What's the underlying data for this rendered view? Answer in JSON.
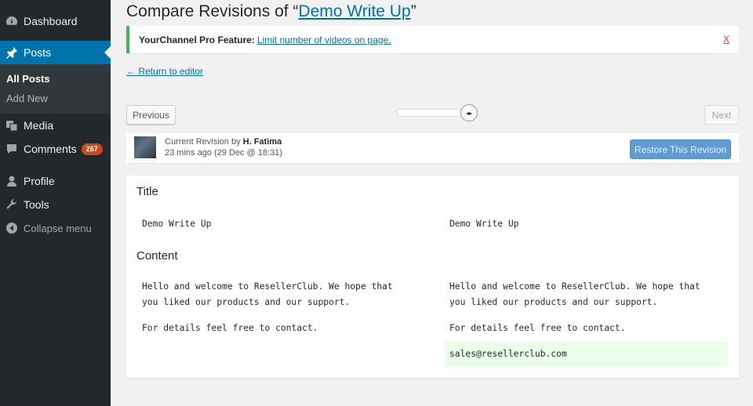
{
  "sidebar": {
    "items": [
      {
        "key": "dashboard",
        "label": "Dashboard",
        "icon": "dashboard-icon"
      },
      {
        "key": "posts",
        "label": "Posts",
        "icon": "pin-icon"
      },
      {
        "key": "media",
        "label": "Media",
        "icon": "media-icon"
      },
      {
        "key": "comments",
        "label": "Comments",
        "icon": "comment-icon",
        "badge": "267"
      },
      {
        "key": "profile",
        "label": "Profile",
        "icon": "user-icon"
      },
      {
        "key": "tools",
        "label": "Tools",
        "icon": "wrench-icon"
      }
    ],
    "submenu": [
      "All Posts",
      "Add New"
    ],
    "collapse_label": "Collapse menu"
  },
  "page": {
    "title_prefix": "Compare Revisions of “",
    "title_link": "Demo Write Up",
    "title_suffix": "”"
  },
  "notice": {
    "label": "YourChannel Pro Feature:",
    "link": "Limit number of videos on page.",
    "dismiss": "X"
  },
  "return_link": "← Return to editor",
  "nav": {
    "previous": "Previous",
    "next": "Next",
    "slider_glyph": "◂▸"
  },
  "revision": {
    "label": "Current Revision by",
    "author": "H. Fatima",
    "time": "23 mins ago (29 Dec @ 18:31)",
    "restore": "Restore This Revision"
  },
  "diff": {
    "title_heading": "Title",
    "content_heading": "Content",
    "left": {
      "title": "Demo Write Up",
      "content_line1": "Hello and welcome to ResellerClub. We hope that",
      "content_line2": "you liked our products and our support.",
      "content_line3": "For details feel free to contact."
    },
    "right": {
      "title": "Demo Write Up",
      "content_line1": "Hello and welcome to ResellerClub. We hope that",
      "content_line2": "you liked our products and our support.",
      "content_line3": "For details feel free to contact.",
      "added_line": "sales@resellerclub.com"
    }
  },
  "colors": {
    "sidebar_bg": "#23282d",
    "active_menu": "#0073aa",
    "link": "#0073aa",
    "notice_border": "#46b450",
    "added_bg": "#e9ffe9",
    "badge": "#ca4a1f"
  }
}
